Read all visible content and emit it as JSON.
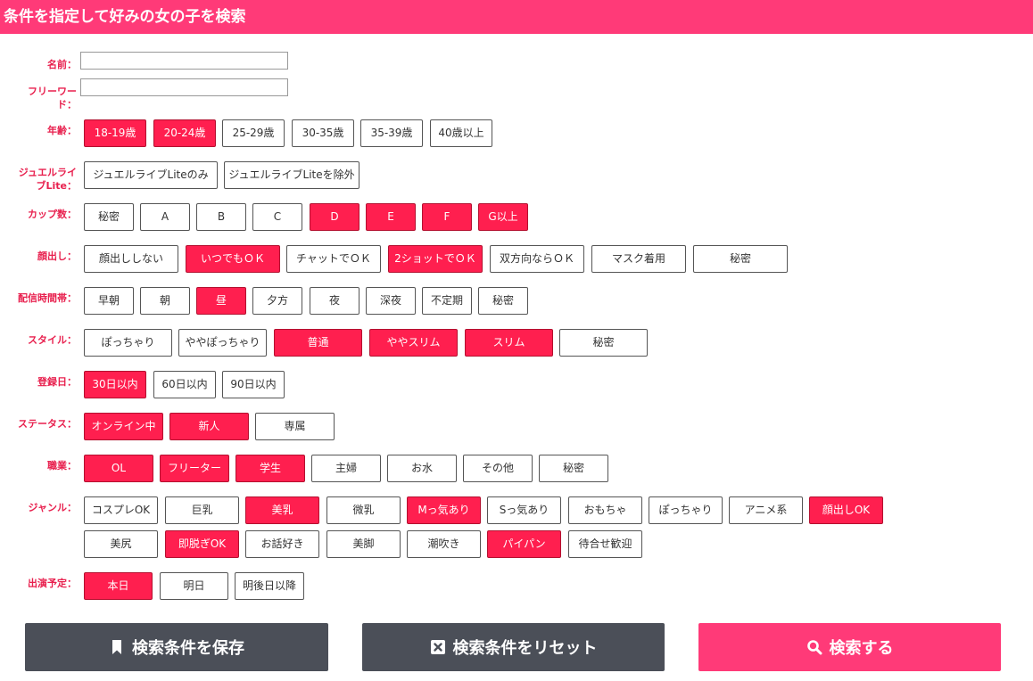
{
  "header": {
    "title": "条件を指定して好みの女の子を検索"
  },
  "fields": {
    "name_label": "名前：",
    "name_value": "",
    "freeword_label_1": "フリーワー",
    "freeword_label_2": "ド：",
    "freeword_value": ""
  },
  "groups": {
    "age": {
      "label": "年齢：",
      "options": [
        "18-19歳",
        "20-24歳",
        "25-29歳",
        "30-35歳",
        "35-39歳",
        "40歳以上"
      ]
    },
    "lite": {
      "label_1": "ジュエルライ",
      "label_2": "ブLite：",
      "options": [
        "ジュエルライブLiteのみ",
        "ジュエルライブLiteを除外"
      ]
    },
    "cup": {
      "label": "カップ数：",
      "options": [
        "秘密",
        "A",
        "B",
        "C",
        "D",
        "E",
        "F",
        "G以上"
      ]
    },
    "face": {
      "label": "顔出し：",
      "options": [
        "顔出ししない",
        "いつでもＯＫ",
        "チャットでＯＫ",
        "2ショットでＯＫ",
        "双方向ならＯＫ",
        "マスク着用",
        "秘密"
      ]
    },
    "time": {
      "label": "配信時間帯：",
      "options": [
        "早朝",
        "朝",
        "昼",
        "夕方",
        "夜",
        "深夜",
        "不定期",
        "秘密"
      ]
    },
    "style": {
      "label": "スタイル：",
      "options": [
        "ぽっちゃり",
        "ややぽっちゃり",
        "普通",
        "ややスリム",
        "スリム",
        "秘密"
      ]
    },
    "reg": {
      "label": "登録日：",
      "options": [
        "30日以内",
        "60日以内",
        "90日以内"
      ]
    },
    "status": {
      "label": "ステータス：",
      "options": [
        "オンライン中",
        "新人",
        "専属"
      ]
    },
    "job": {
      "label": "職業：",
      "options": [
        "OL",
        "フリーター",
        "学生",
        "主婦",
        "お水",
        "その他",
        "秘密"
      ]
    },
    "genre": {
      "label": "ジャンル：",
      "options": [
        "コスプレOK",
        "巨乳",
        "美乳",
        "微乳",
        "Mっ気あり",
        "Sっ気あり",
        "おもちゃ",
        "ぽっちゃり",
        "アニメ系",
        "顔出しOK",
        "美尻",
        "即脱ぎOK",
        "お話好き",
        "美脚",
        "潮吹き",
        "パイパン",
        "待合せ歓迎"
      ]
    },
    "sched": {
      "label": "出演予定：",
      "options": [
        "本日",
        "明日",
        "明後日以降"
      ]
    }
  },
  "actions": {
    "save": "検索条件を保存",
    "reset": "検索条件をリセット",
    "search": "検索する"
  },
  "colors": {
    "accent": "#ff3a78",
    "selected": "#ff1f4f",
    "label": "#e8204e",
    "dark_button": "#4b4f58"
  }
}
